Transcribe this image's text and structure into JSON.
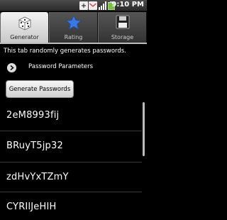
{
  "status_bar": {
    "time": "9:10 PM",
    "icons": [
      "usb-icon",
      "gmail-icon",
      "signal-icon",
      "battery-icon"
    ]
  },
  "tabs": [
    {
      "label": "Generator",
      "icon": "dice-icon",
      "selected": true
    },
    {
      "label": "Rating",
      "icon": "star-icon",
      "selected": false
    },
    {
      "label": "Storage",
      "icon": "floppy-disk-icon",
      "selected": false
    }
  ],
  "main": {
    "description": "This tab randomly generates passwords.",
    "params_label": "Password Parameters",
    "generate_button": "Generate Passwords",
    "passwords": [
      "2eM8993fij",
      "BRuyT5jp32",
      "zdHvYxTZmY",
      "CYRIlJeHIH"
    ]
  },
  "colors": {
    "background": "#000000",
    "tab_selected": "#e6e6e6",
    "star": "#3a78e8"
  }
}
